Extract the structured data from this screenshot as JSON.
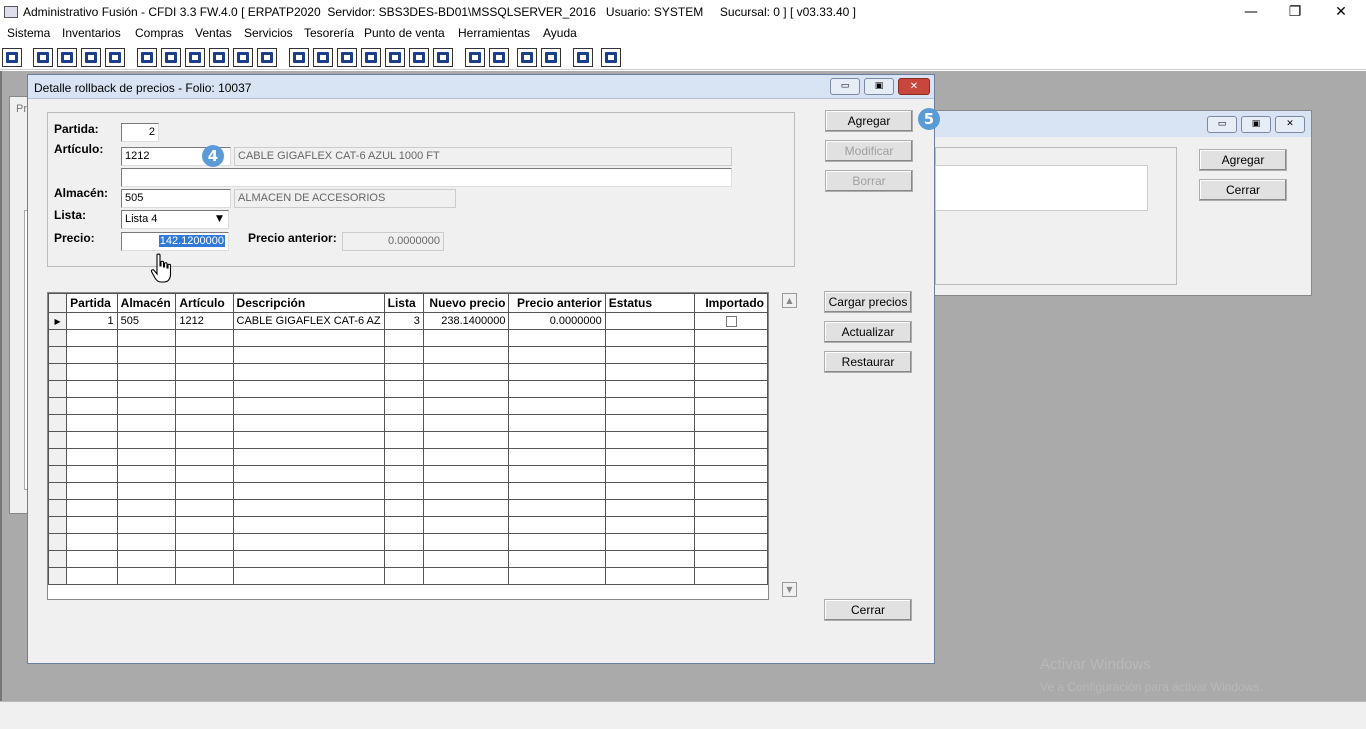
{
  "app": {
    "title": "Administrativo Fusión - CFDI 3.3 FW.4.0 [ ERPATP2020  Servidor: SBS3DES-BD01\\MSSQLSERVER_2016   Usuario: SYSTEM     Sucursal: 0 ] [ v03.33.40 ]",
    "minimize": "—",
    "restore": "❐",
    "close": "✕"
  },
  "menu": [
    "Sistema",
    "Inventarios",
    "Compras",
    "Ventas",
    "Servicios",
    "Tesorería",
    "Punto de venta",
    "Herramientas",
    "Ayuda"
  ],
  "bg_window": {
    "fragment": "Pr",
    "agregar": "Agregar",
    "cerrar": "Cerrar"
  },
  "dialog": {
    "title": "Detalle rollback de precios - Folio: 10037",
    "labels": {
      "partida": "Partida:",
      "articulo": "Artículo:",
      "almacen": "Almacén:",
      "lista": "Lista:",
      "precio": "Precio:",
      "precio_anterior": "Precio anterior:"
    },
    "fields": {
      "partida": "2",
      "articulo": "1212",
      "articulo_desc": "CABLE GIGAFLEX CAT-6 AZUL 1000 FT",
      "articulo_desc2": "",
      "almacen": "505",
      "almacen_desc": "ALMACEN DE ACCESORIOS",
      "lista": "Lista 4",
      "precio": "142.1200000",
      "precio_anterior": "0.0000000"
    },
    "badges": {
      "b4": "4",
      "b5": "5"
    },
    "buttons": {
      "agregar": "Agregar",
      "modificar": "Modificar",
      "borrar": "Borrar",
      "cargar_precios": "Cargar precios",
      "actualizar": "Actualizar",
      "restaurar": "Restaurar",
      "cerrar": "Cerrar"
    },
    "grid": {
      "columns": [
        "Partida",
        "Almacén",
        "Artículo",
        "Descripción",
        "Lista",
        "Nuevo precio",
        "Precio anterior",
        "Estatus",
        "Importado"
      ],
      "rows": [
        {
          "indicator": "▶",
          "partida": "1",
          "almacen": "505",
          "articulo": "1212",
          "descripcion": "CABLE GIGAFLEX CAT-6 AZ",
          "lista": "3",
          "nuevo_precio": "238.1400000",
          "precio_anterior": "0.0000000",
          "estatus": "",
          "importado": false
        }
      ],
      "scroll_up": "▲",
      "scroll_down": "▼"
    }
  },
  "watermark": {
    "line1": "Activar Windows",
    "line2": "Ve a Configuración para activar Windows."
  }
}
